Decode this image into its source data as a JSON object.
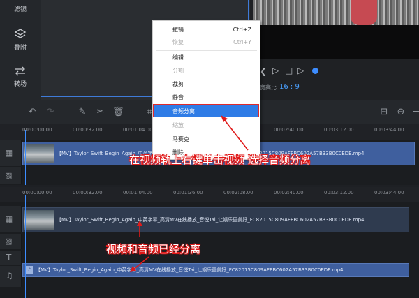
{
  "sidebar": {
    "items": [
      {
        "label": "滤镜",
        "icon": "filter-icon"
      },
      {
        "label": "叠附",
        "icon": "overlay-icon"
      },
      {
        "label": "转场",
        "icon": "transition-icon"
      }
    ]
  },
  "preview": {
    "aspect_label": "宽高比:",
    "aspect_value": "16 : 9"
  },
  "ruler": {
    "ticks": [
      "00:00:00.00",
      "00:00:32.00",
      "00:01:04.00",
      "00:01:36.00",
      "00:02:08.00",
      "00:02:40.00",
      "00:03:12.00",
      "00:03:44.00"
    ]
  },
  "timeline_top": {
    "video_clip_name": "【MV】Taylor_Swift_Begin_Again_中英字幕_高清MV在线播放_音悦Tai_让娱乐更美好_FC82015C809AFEBC602A57B33B0C0EDE.mp4"
  },
  "timeline_bottom": {
    "video_clip_name": "【MV】Taylor_Swift_Begin_Again_中英字幕_高清MV在线播放_音悦Tai_让娱乐更美好_FC82015C809AFEBC602A57B33B0C0EDE.mp4",
    "audio_clip_name": "【MV】Taylor_Swift_Begin_Again_中英字幕_高清MV在线播放_音悦Tai_让娱乐更美好_FC82015C809AFEBC602A57B33B0C0EDE.mp4"
  },
  "context_menu": {
    "undo": "撤销",
    "undo_shortcut": "Ctrl+Z",
    "redo": "恢复",
    "redo_shortcut": "Ctrl+Y",
    "edit": "编辑",
    "split": "分割",
    "crop": "裁剪",
    "mute": "静音",
    "audio_detach": "音频分离",
    "zoom": "缩放",
    "mosaic": "马赛克",
    "delete": "删除"
  },
  "annotations": {
    "top": "在视频轨上右键单击视频 选择音频分离",
    "bottom": "视频和音频已经分离"
  },
  "colors": {
    "accent": "#3d8dff",
    "highlight": "#2f7ce6",
    "annotation_red": "#e01a1a",
    "clip_blue": "#3f5f9e"
  }
}
